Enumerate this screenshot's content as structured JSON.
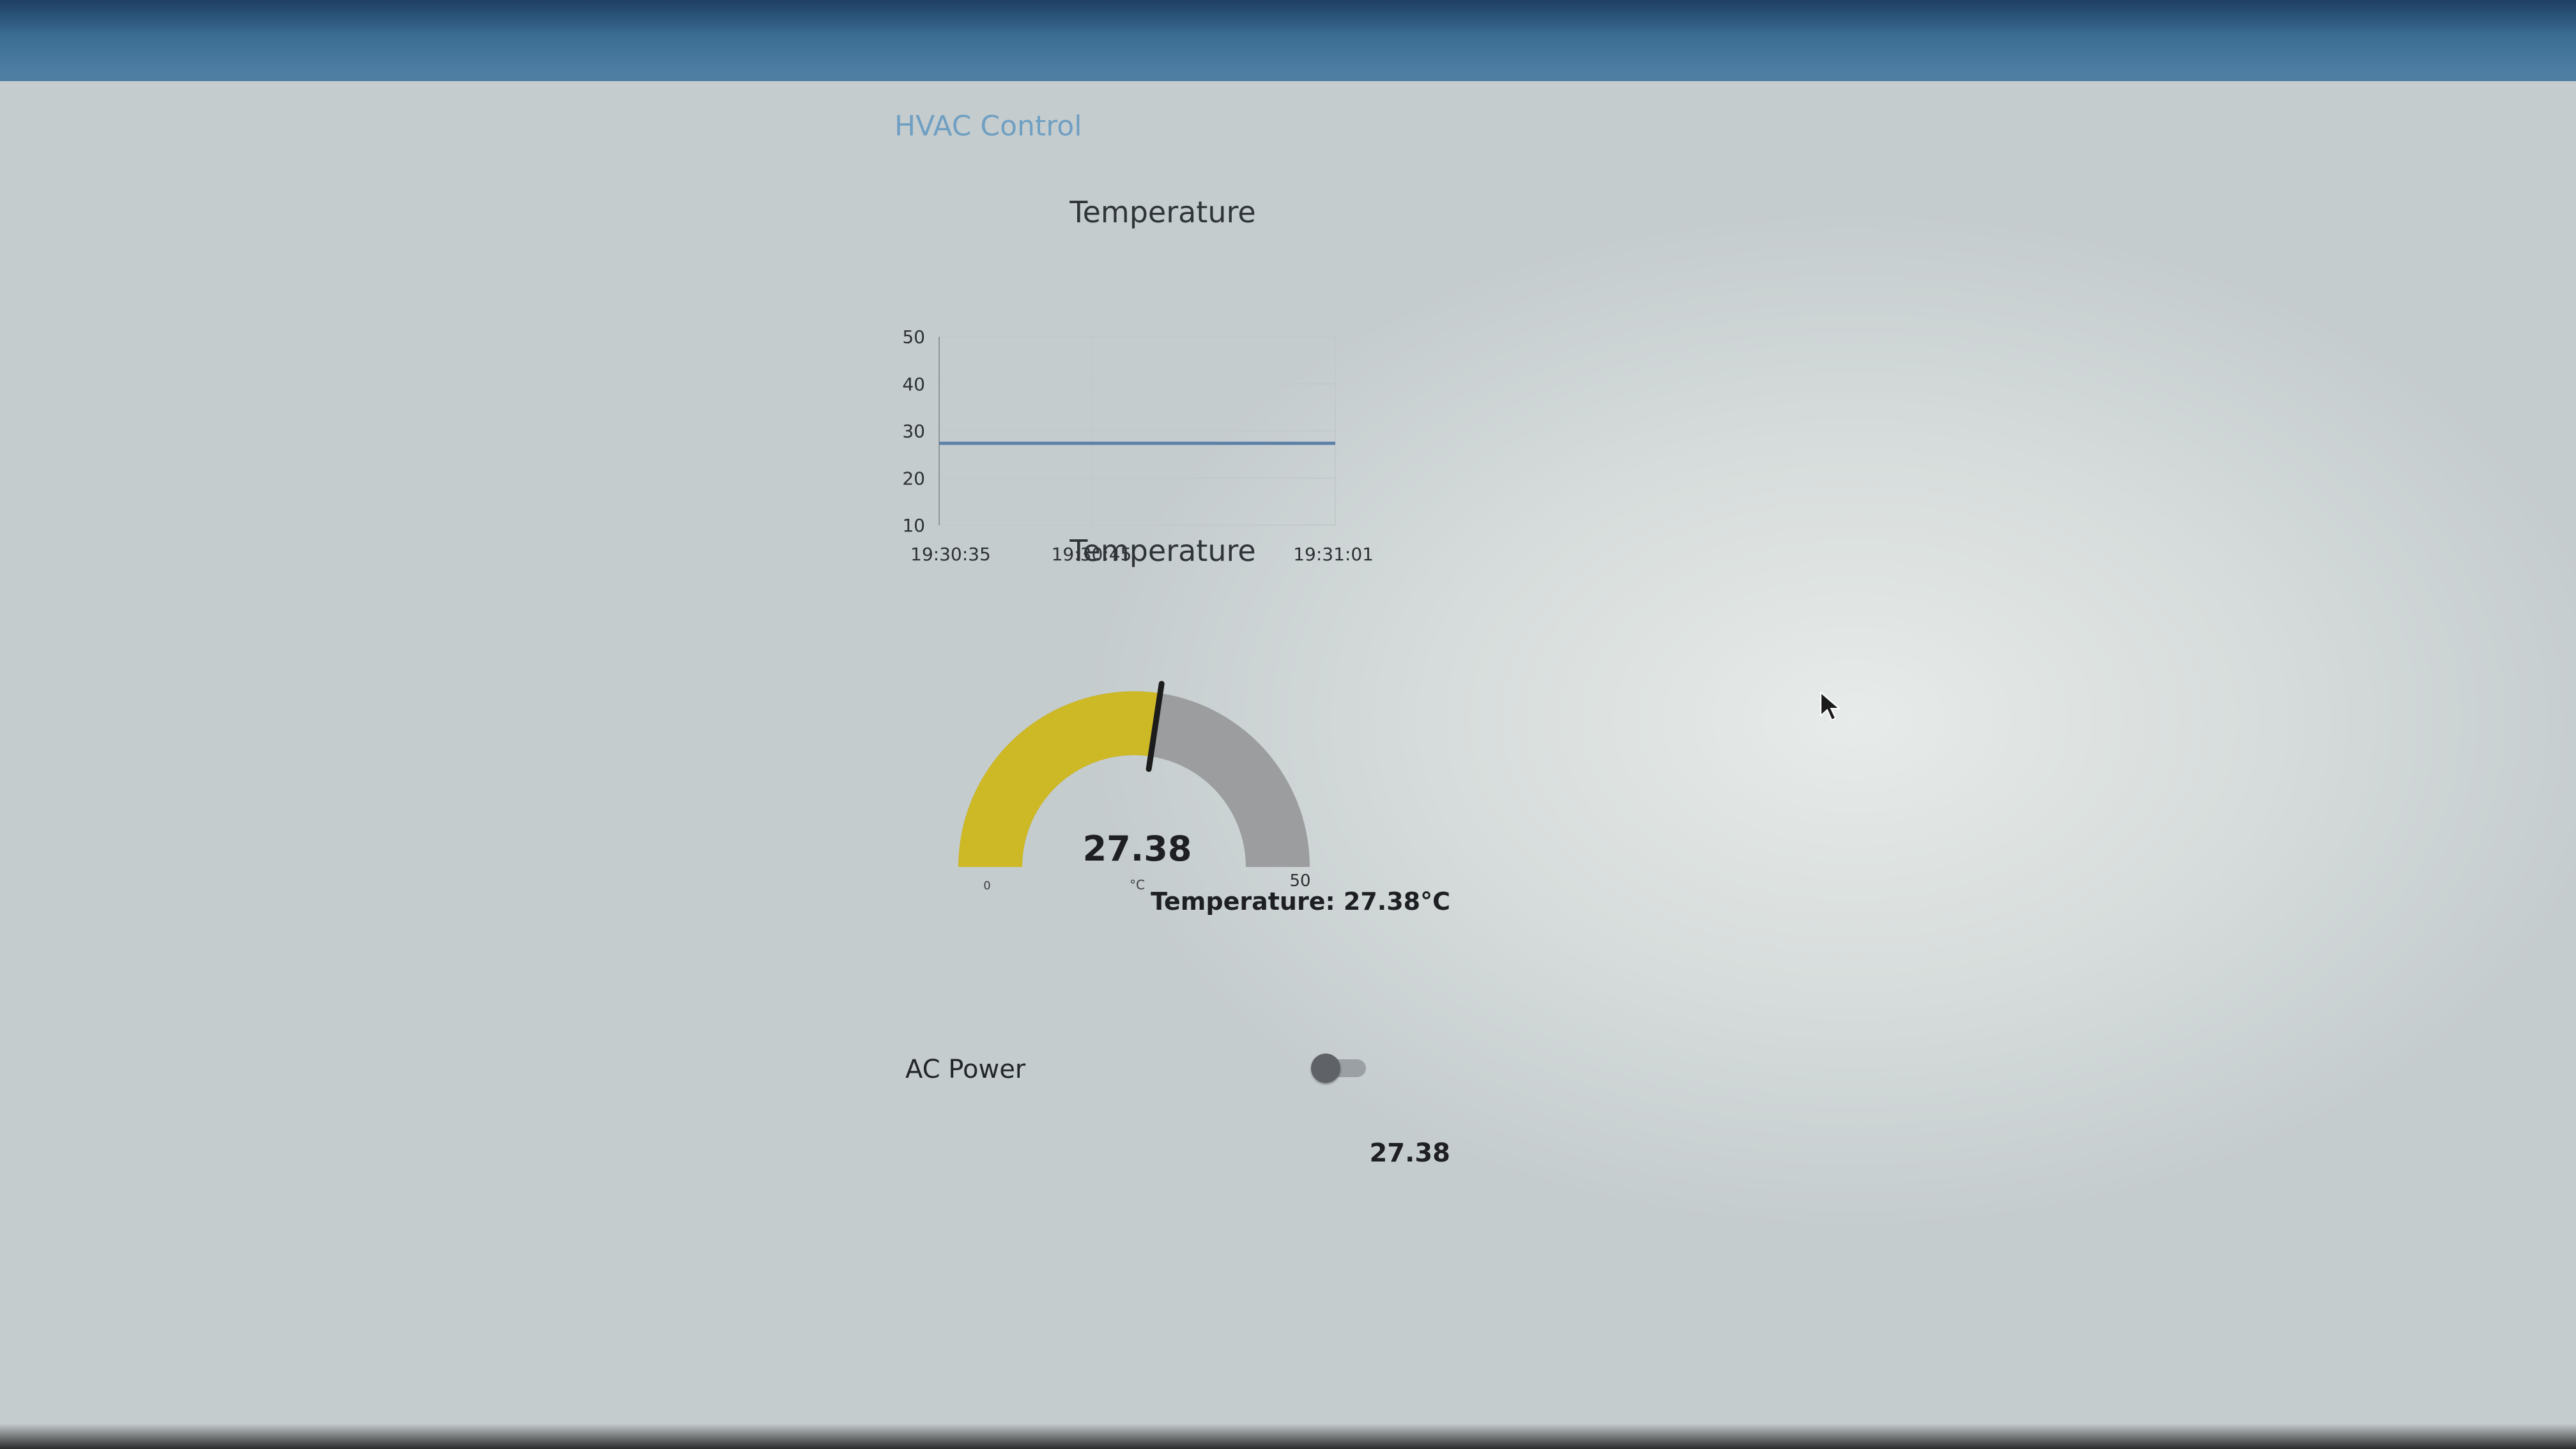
{
  "group": {
    "title": "HVAC Control"
  },
  "chart_data": {
    "type": "line",
    "title": "Temperature",
    "xlabel": "",
    "ylabel": "",
    "ylim": [
      10,
      50
    ],
    "yticks": [
      10,
      20,
      30,
      40,
      50
    ],
    "x_tick_labels": [
      "19:30:35",
      "19:30:45",
      "19:31:01"
    ],
    "x": [
      "19:30:35",
      "19:30:45",
      "19:31:01"
    ],
    "series": [
      {
        "values": [
          27.38,
          27.38,
          27.38
        ]
      }
    ],
    "grid": true,
    "colors": {
      "line": "#5b7fa6",
      "grid": "#c2c9cc"
    }
  },
  "gauge": {
    "title": "Temperature",
    "value": 27.38,
    "value_text": "27.38",
    "unit": "°C",
    "min": 0,
    "max": 50,
    "min_label": "0",
    "max_label": "50",
    "colors": {
      "fill": "#cdb825",
      "empty": "#9b9d9e",
      "needle": "#1c1c1c"
    }
  },
  "temperature_text": "Temperature: 27.38°C",
  "ac_power": {
    "label": "AC Power",
    "state": "off"
  },
  "bottom_value": "27.38",
  "icons": {
    "cursor": "mouse-cursor-icon"
  }
}
